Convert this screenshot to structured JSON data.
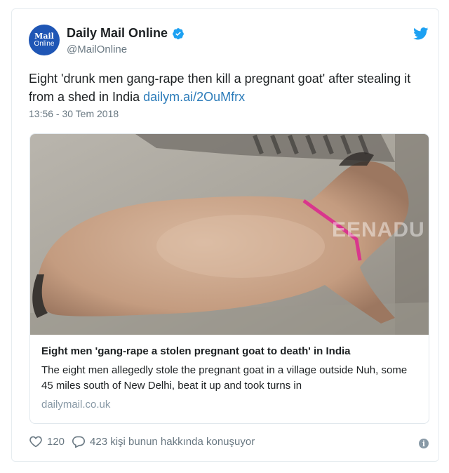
{
  "account": {
    "name": "Daily Mail Online",
    "handle": "@MailOnline",
    "avatar_line1": "Mail",
    "avatar_line2": "Online"
  },
  "tweet": {
    "text": "Eight 'drunk men gang-rape then kill a pregnant goat' after stealing it from a shed in India ",
    "link": "dailym.ai/2OuMfrx",
    "timestamp": "13:56 - 30 Tem 2018"
  },
  "card": {
    "watermark": "EENADU",
    "title": "Eight men 'gang-rape a stolen pregnant goat to death' in India",
    "description": "The eight men allegedly stole the pregnant goat in a village outside Nuh, some 45 miles south of New Delhi, beat it up and took turns in",
    "domain": "dailymail.co.uk"
  },
  "actions": {
    "likes": "120",
    "replies_text": "423 kişi bunun hakkında konuşuyor"
  },
  "icons": {
    "verified": "verified-badge-icon",
    "bird": "twitter-bird-icon",
    "heart": "heart-icon",
    "reply": "reply-bubble-icon",
    "info": "info-icon"
  },
  "colors": {
    "link": "#2b7bb9",
    "verified": "#1da1f2",
    "avatar_bg": "#1f56b5",
    "muted": "#697882"
  }
}
